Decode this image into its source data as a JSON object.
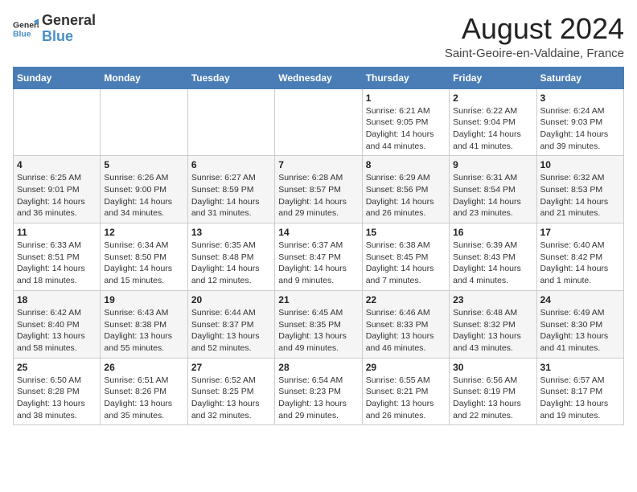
{
  "logo": {
    "general": "General",
    "blue": "Blue"
  },
  "title": "August 2024",
  "subtitle": "Saint-Geoire-en-Valdaine, France",
  "days_of_week": [
    "Sunday",
    "Monday",
    "Tuesday",
    "Wednesday",
    "Thursday",
    "Friday",
    "Saturday"
  ],
  "weeks": [
    [
      {
        "day": "",
        "info": ""
      },
      {
        "day": "",
        "info": ""
      },
      {
        "day": "",
        "info": ""
      },
      {
        "day": "",
        "info": ""
      },
      {
        "day": "1",
        "info": "Sunrise: 6:21 AM\nSunset: 9:05 PM\nDaylight: 14 hours and 44 minutes."
      },
      {
        "day": "2",
        "info": "Sunrise: 6:22 AM\nSunset: 9:04 PM\nDaylight: 14 hours and 41 minutes."
      },
      {
        "day": "3",
        "info": "Sunrise: 6:24 AM\nSunset: 9:03 PM\nDaylight: 14 hours and 39 minutes."
      }
    ],
    [
      {
        "day": "4",
        "info": "Sunrise: 6:25 AM\nSunset: 9:01 PM\nDaylight: 14 hours and 36 minutes."
      },
      {
        "day": "5",
        "info": "Sunrise: 6:26 AM\nSunset: 9:00 PM\nDaylight: 14 hours and 34 minutes."
      },
      {
        "day": "6",
        "info": "Sunrise: 6:27 AM\nSunset: 8:59 PM\nDaylight: 14 hours and 31 minutes."
      },
      {
        "day": "7",
        "info": "Sunrise: 6:28 AM\nSunset: 8:57 PM\nDaylight: 14 hours and 29 minutes."
      },
      {
        "day": "8",
        "info": "Sunrise: 6:29 AM\nSunset: 8:56 PM\nDaylight: 14 hours and 26 minutes."
      },
      {
        "day": "9",
        "info": "Sunrise: 6:31 AM\nSunset: 8:54 PM\nDaylight: 14 hours and 23 minutes."
      },
      {
        "day": "10",
        "info": "Sunrise: 6:32 AM\nSunset: 8:53 PM\nDaylight: 14 hours and 21 minutes."
      }
    ],
    [
      {
        "day": "11",
        "info": "Sunrise: 6:33 AM\nSunset: 8:51 PM\nDaylight: 14 hours and 18 minutes."
      },
      {
        "day": "12",
        "info": "Sunrise: 6:34 AM\nSunset: 8:50 PM\nDaylight: 14 hours and 15 minutes."
      },
      {
        "day": "13",
        "info": "Sunrise: 6:35 AM\nSunset: 8:48 PM\nDaylight: 14 hours and 12 minutes."
      },
      {
        "day": "14",
        "info": "Sunrise: 6:37 AM\nSunset: 8:47 PM\nDaylight: 14 hours and 9 minutes."
      },
      {
        "day": "15",
        "info": "Sunrise: 6:38 AM\nSunset: 8:45 PM\nDaylight: 14 hours and 7 minutes."
      },
      {
        "day": "16",
        "info": "Sunrise: 6:39 AM\nSunset: 8:43 PM\nDaylight: 14 hours and 4 minutes."
      },
      {
        "day": "17",
        "info": "Sunrise: 6:40 AM\nSunset: 8:42 PM\nDaylight: 14 hours and 1 minute."
      }
    ],
    [
      {
        "day": "18",
        "info": "Sunrise: 6:42 AM\nSunset: 8:40 PM\nDaylight: 13 hours and 58 minutes."
      },
      {
        "day": "19",
        "info": "Sunrise: 6:43 AM\nSunset: 8:38 PM\nDaylight: 13 hours and 55 minutes."
      },
      {
        "day": "20",
        "info": "Sunrise: 6:44 AM\nSunset: 8:37 PM\nDaylight: 13 hours and 52 minutes."
      },
      {
        "day": "21",
        "info": "Sunrise: 6:45 AM\nSunset: 8:35 PM\nDaylight: 13 hours and 49 minutes."
      },
      {
        "day": "22",
        "info": "Sunrise: 6:46 AM\nSunset: 8:33 PM\nDaylight: 13 hours and 46 minutes."
      },
      {
        "day": "23",
        "info": "Sunrise: 6:48 AM\nSunset: 8:32 PM\nDaylight: 13 hours and 43 minutes."
      },
      {
        "day": "24",
        "info": "Sunrise: 6:49 AM\nSunset: 8:30 PM\nDaylight: 13 hours and 41 minutes."
      }
    ],
    [
      {
        "day": "25",
        "info": "Sunrise: 6:50 AM\nSunset: 8:28 PM\nDaylight: 13 hours and 38 minutes."
      },
      {
        "day": "26",
        "info": "Sunrise: 6:51 AM\nSunset: 8:26 PM\nDaylight: 13 hours and 35 minutes."
      },
      {
        "day": "27",
        "info": "Sunrise: 6:52 AM\nSunset: 8:25 PM\nDaylight: 13 hours and 32 minutes."
      },
      {
        "day": "28",
        "info": "Sunrise: 6:54 AM\nSunset: 8:23 PM\nDaylight: 13 hours and 29 minutes."
      },
      {
        "day": "29",
        "info": "Sunrise: 6:55 AM\nSunset: 8:21 PM\nDaylight: 13 hours and 26 minutes."
      },
      {
        "day": "30",
        "info": "Sunrise: 6:56 AM\nSunset: 8:19 PM\nDaylight: 13 hours and 22 minutes."
      },
      {
        "day": "31",
        "info": "Sunrise: 6:57 AM\nSunset: 8:17 PM\nDaylight: 13 hours and 19 minutes."
      }
    ]
  ]
}
